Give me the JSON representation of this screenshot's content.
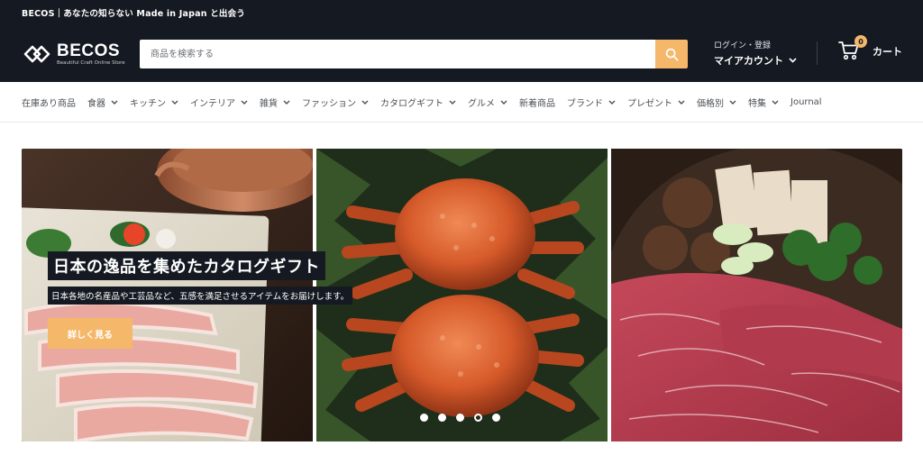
{
  "announcement": {
    "text": "BECOS｜あなたの知らない Made in Japan と出会う"
  },
  "header": {
    "logo_name": "BECOS",
    "logo_tagline": "Beautiful Craft Online Store",
    "search_placeholder": "商品を検索する",
    "account_small": "ログイン・登録",
    "account_big": "マイアカウント",
    "cart_count": "0",
    "cart_label": "カート",
    "accent_color": "#f5b86a",
    "background_color": "#151a22"
  },
  "nav": {
    "items": [
      {
        "label": "在庫あり商品",
        "has_dropdown": false
      },
      {
        "label": "食器",
        "has_dropdown": true
      },
      {
        "label": "キッチン",
        "has_dropdown": true
      },
      {
        "label": "インテリア",
        "has_dropdown": true
      },
      {
        "label": "雑貨",
        "has_dropdown": true
      },
      {
        "label": "ファッション",
        "has_dropdown": true
      },
      {
        "label": "カタログギフト",
        "has_dropdown": true
      },
      {
        "label": "グルメ",
        "has_dropdown": true
      },
      {
        "label": "新着商品",
        "has_dropdown": false
      },
      {
        "label": "ブランド",
        "has_dropdown": true
      },
      {
        "label": "プレゼント",
        "has_dropdown": true
      },
      {
        "label": "価格別",
        "has_dropdown": true
      },
      {
        "label": "特集",
        "has_dropdown": true
      },
      {
        "label": "Journal",
        "has_dropdown": false
      }
    ]
  },
  "hero": {
    "title": "日本の逸品を集めたカタログギフト",
    "subtitle": "日本各地の名産品や工芸品など、五感を満足させるアイテムをお届けします。",
    "button_label": "詳しく見る",
    "images": [
      "pork-on-stone-plate-image",
      "hairy-crabs-image",
      "wagyu-beef-image"
    ],
    "slide_count": 5,
    "active_slide": 4
  }
}
